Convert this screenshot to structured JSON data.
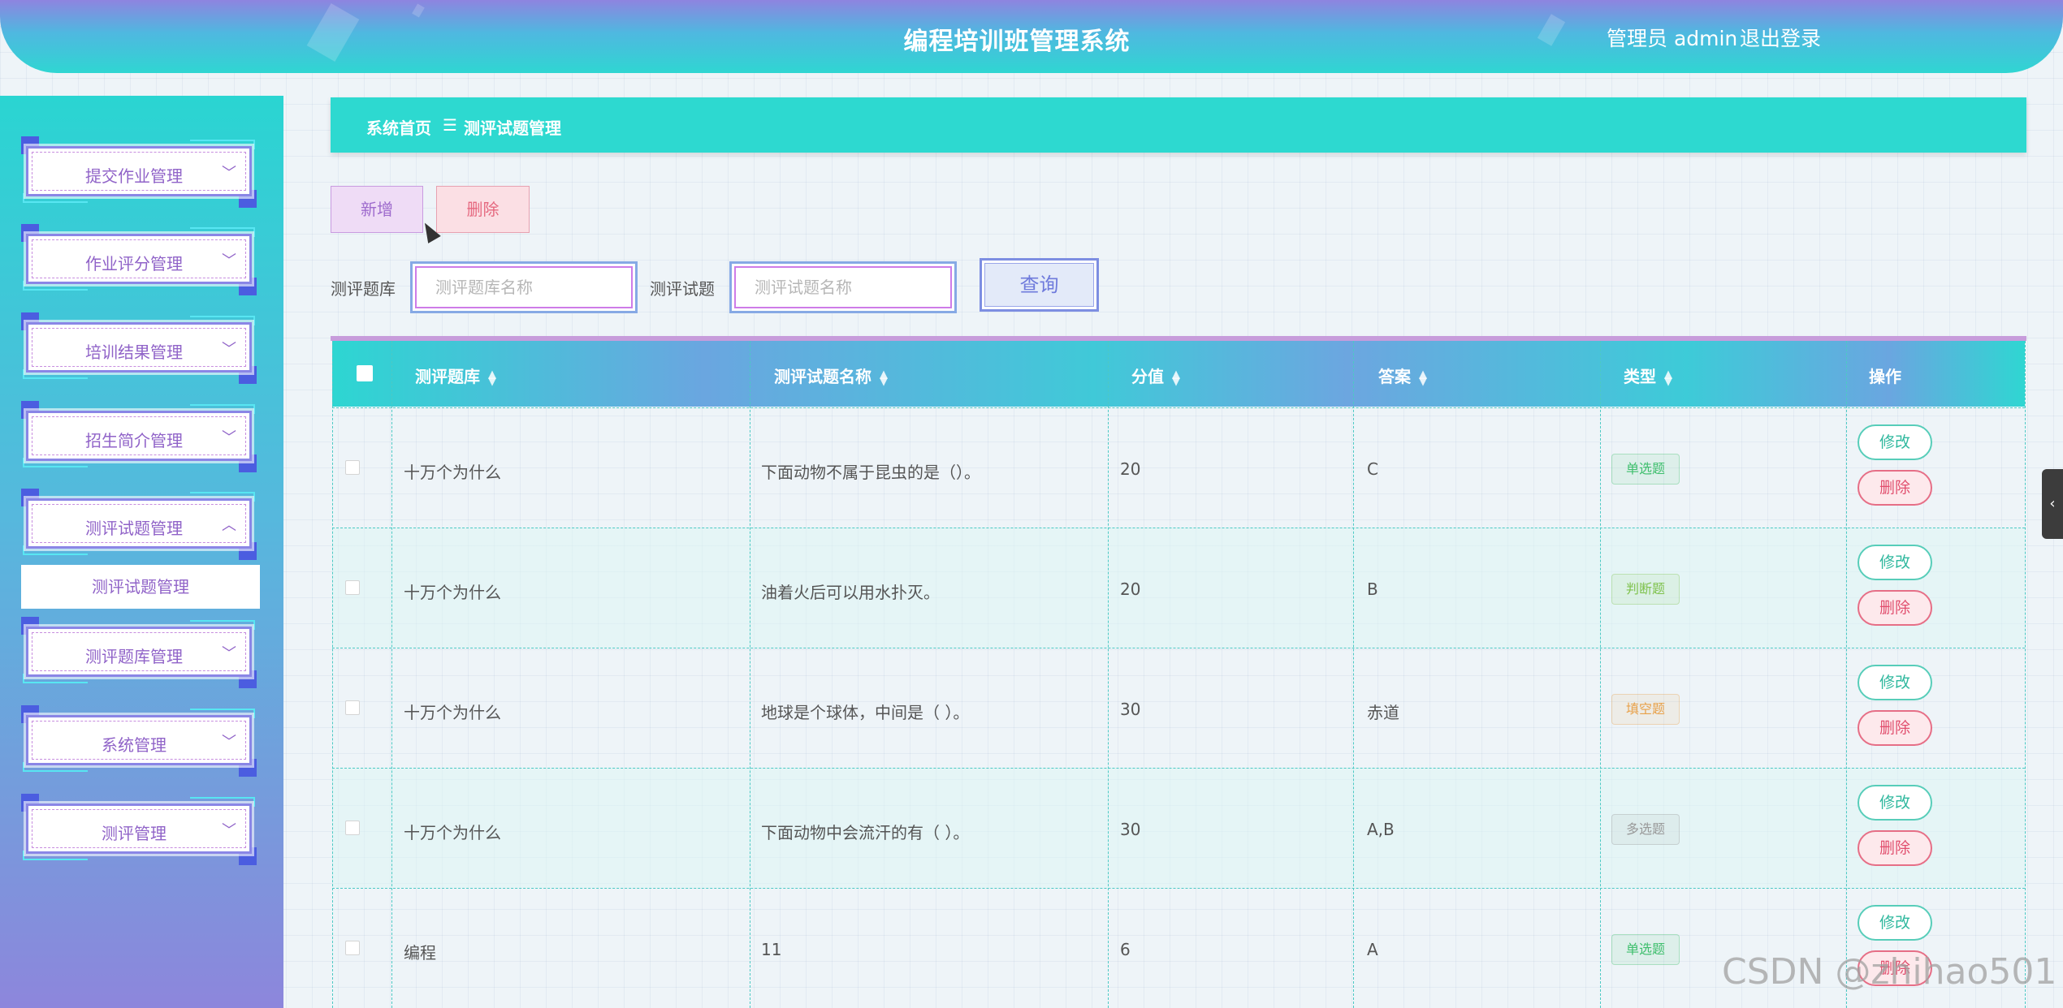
{
  "header": {
    "title": "编程培训班管理系统",
    "user": "管理员 admin",
    "logout": "退出登录"
  },
  "sidebar": {
    "items": [
      {
        "label": "提交作业管理",
        "chevron": "chevron-down-icon"
      },
      {
        "label": "作业评分管理",
        "chevron": "chevron-down-icon"
      },
      {
        "label": "培训结果管理",
        "chevron": "chevron-down-icon"
      },
      {
        "label": "招生简介管理",
        "chevron": "chevron-down-icon"
      },
      {
        "label": "测评试题管理",
        "chevron": "chevron-up-icon"
      },
      {
        "label": "测评题库管理",
        "chevron": "chevron-down-icon"
      },
      {
        "label": "系统管理",
        "chevron": "chevron-down-icon"
      },
      {
        "label": "测评管理",
        "chevron": "chevron-down-icon"
      }
    ],
    "submenu": "测评试题管理"
  },
  "breadcrumb": {
    "home": "系统首页",
    "separator": "☰",
    "current": "测评试题管理"
  },
  "toolbar": {
    "add": "新增",
    "delete": "删除"
  },
  "search": {
    "bank_label": "测评题库",
    "bank_placeholder": "测评题库名称",
    "question_label": "测评试题",
    "question_placeholder": "测评试题名称",
    "query": "查询"
  },
  "table": {
    "headers": [
      "测评题库",
      "测评试题名称",
      "分值",
      "答案",
      "类型",
      "操作"
    ],
    "rows": [
      {
        "bank": "十万个为什么",
        "name": "下面动物不属于昆虫的是（）。",
        "score": "20",
        "answer": "C",
        "type": "单选题",
        "type_color": "#3fbf6d",
        "edit": "修改",
        "delete": "删除"
      },
      {
        "bank": "十万个为什么",
        "name": "油着火后可以用水扑灭。",
        "score": "20",
        "answer": "B",
        "type": "判断题",
        "type_color": "#7fc24d",
        "edit": "修改",
        "delete": "删除"
      },
      {
        "bank": "十万个为什么",
        "name": "地球是个球体，中间是（ ）。",
        "score": "30",
        "answer": "赤道",
        "type": "填空题",
        "type_color": "#e8a14a",
        "edit": "修改",
        "delete": "删除"
      },
      {
        "bank": "十万个为什么",
        "name": "下面动物中会流汗的有（ ）。",
        "score": "30",
        "answer": "A,B",
        "type": "多选题",
        "type_color": "#999999",
        "edit": "修改",
        "delete": "删除"
      },
      {
        "bank": "编程",
        "name": "11",
        "score": "6",
        "answer": "A",
        "type": "单选题",
        "type_color": "#3fbf6d",
        "edit": "修改",
        "delete": "删除"
      }
    ]
  },
  "watermark": "CSDN @zhihao501",
  "colors": {
    "accent": "#2dd9d0",
    "sidebar_top": "#2ad5d2",
    "sidebar_bottom": "#8d86dc",
    "menu_text": "#9063c8"
  }
}
